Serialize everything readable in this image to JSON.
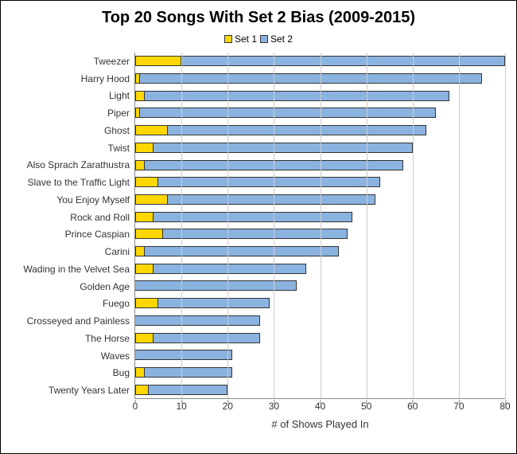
{
  "chart_data": {
    "type": "bar",
    "orientation": "horizontal",
    "stacked": true,
    "title": "Top 20 Songs With Set 2 Bias (2009-2015)",
    "xlabel": "# of Shows Played In",
    "ylabel": "",
    "xlim": [
      0,
      80
    ],
    "xticks": [
      0,
      10,
      20,
      30,
      40,
      50,
      60,
      70,
      80
    ],
    "legend_position": "top",
    "categories": [
      "Tweezer",
      "Harry Hood",
      "Light",
      "Piper",
      "Ghost",
      "Twist",
      "Also Sprach Zarathustra",
      "Slave to the Traffic Light",
      "You Enjoy Myself",
      "Rock and Roll",
      "Prince Caspian",
      "Carini",
      "Wading in the Velvet Sea",
      "Golden Age",
      "Fuego",
      "Crosseyed and Painless",
      "The Horse",
      "Waves",
      "Bug",
      "Twenty Years Later"
    ],
    "series": [
      {
        "name": "Set 1",
        "color": "#ffd700",
        "values": [
          10,
          1,
          2,
          1,
          7,
          4,
          2,
          5,
          7,
          4,
          6,
          2,
          4,
          0,
          5,
          0,
          4,
          0,
          2,
          3
        ]
      },
      {
        "name": "Set 2",
        "color": "#8bb3e0",
        "values": [
          70,
          74,
          66,
          64,
          56,
          56,
          56,
          48,
          45,
          43,
          40,
          42,
          33,
          35,
          24,
          27,
          23,
          21,
          19,
          17
        ]
      }
    ]
  }
}
